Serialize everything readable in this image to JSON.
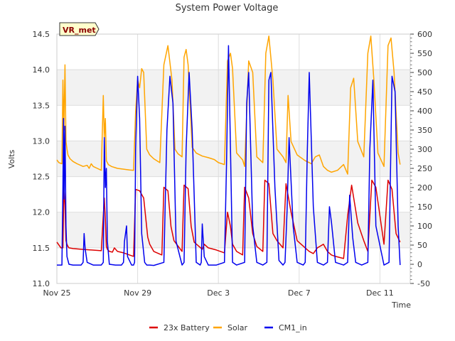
{
  "chart_data": {
    "type": "line",
    "title": "System Power Voltage",
    "xlabel": "Time",
    "ylabel": "Volts",
    "site_badge": "VR_met",
    "x_ticks": [
      "Nov 25",
      "Nov 29",
      "Dec 3",
      "Dec 7",
      "Dec 11"
    ],
    "y_left_ticks": [
      "11.0",
      "11.5",
      "12.0",
      "12.5",
      "13.0",
      "13.5",
      "14.0",
      "14.5"
    ],
    "y_right_ticks": [
      "-50",
      "0",
      "50",
      "100",
      "150",
      "200",
      "250",
      "300",
      "350",
      "400",
      "450",
      "500",
      "550",
      "600"
    ],
    "x_range_days": [
      0,
      17.5
    ],
    "ylim_left": [
      11.0,
      14.5
    ],
    "ylim_right": [
      -50,
      600
    ],
    "legend_position": "bottom-center",
    "series": [
      {
        "name": "23x Battery",
        "axis": "left",
        "color": "#dd0000",
        "note": "x in days since Nov 25",
        "x": [
          0.0,
          0.2,
          0.3,
          0.35,
          0.4,
          0.45,
          0.5,
          0.55,
          0.6,
          0.8,
          1.2,
          2.2,
          2.35,
          2.4,
          2.45,
          2.5,
          2.6,
          2.75,
          2.85,
          3.0,
          3.3,
          3.6,
          3.8,
          3.9,
          4.1,
          4.3,
          4.5,
          4.6,
          4.8,
          5.2,
          5.3,
          5.5,
          5.65,
          5.8,
          6.2,
          6.3,
          6.5,
          6.65,
          6.8,
          7.2,
          7.3,
          7.5,
          7.9,
          8.3,
          8.45,
          8.6,
          8.7,
          8.9,
          9.2,
          9.3,
          9.5,
          9.7,
          9.9,
          10.2,
          10.3,
          10.5,
          10.7,
          10.9,
          11.2,
          11.35,
          11.6,
          11.9,
          12.3,
          12.5,
          12.7,
          12.9,
          13.2,
          13.4,
          13.6,
          13.8,
          14.2,
          14.4,
          14.6,
          14.9,
          15.2,
          15.4,
          15.6,
          15.8,
          16.2,
          16.4,
          16.6,
          16.8,
          17.0
        ],
        "values": [
          11.58,
          11.5,
          11.5,
          12.35,
          12.1,
          11.6,
          11.55,
          11.52,
          11.5,
          11.49,
          11.48,
          11.46,
          12.2,
          11.9,
          11.52,
          11.48,
          11.45,
          11.44,
          11.5,
          11.45,
          11.43,
          11.4,
          11.38,
          12.32,
          12.3,
          12.2,
          11.65,
          11.55,
          11.45,
          11.4,
          12.35,
          12.3,
          11.8,
          11.6,
          11.45,
          12.38,
          12.33,
          11.8,
          11.58,
          11.48,
          11.55,
          11.5,
          11.47,
          11.43,
          12.0,
          11.8,
          11.55,
          11.45,
          11.4,
          12.35,
          12.2,
          11.7,
          11.52,
          11.45,
          12.45,
          12.4,
          11.7,
          11.6,
          11.5,
          12.4,
          12.0,
          11.6,
          11.5,
          11.45,
          11.42,
          11.5,
          11.55,
          11.45,
          11.4,
          11.38,
          11.35,
          11.95,
          12.38,
          11.85,
          11.6,
          11.45,
          12.45,
          12.35,
          11.55,
          12.45,
          12.32,
          11.7,
          11.58
        ]
      },
      {
        "name": "Solar",
        "axis": "right",
        "color": "#ffa500",
        "note": "x in days since Nov 25",
        "x": [
          0.0,
          0.1,
          0.25,
          0.3,
          0.35,
          0.4,
          0.45,
          0.5,
          0.55,
          0.65,
          0.8,
          1.0,
          1.3,
          1.5,
          1.6,
          1.7,
          1.8,
          2.0,
          2.2,
          2.3,
          2.35,
          2.4,
          2.45,
          2.55,
          2.7,
          3.0,
          3.3,
          3.6,
          3.8,
          3.9,
          4.0,
          4.1,
          4.2,
          4.3,
          4.45,
          4.6,
          4.8,
          4.95,
          5.1,
          5.3,
          5.5,
          5.7,
          5.85,
          6.0,
          6.2,
          6.3,
          6.4,
          6.5,
          6.7,
          6.9,
          7.2,
          7.5,
          7.8,
          8.0,
          8.3,
          8.45,
          8.6,
          8.7,
          8.9,
          9.2,
          9.3,
          9.5,
          9.7,
          9.9,
          10.2,
          10.35,
          10.5,
          10.7,
          10.9,
          11.2,
          11.35,
          11.45,
          11.6,
          11.9,
          12.3,
          12.5,
          12.6,
          12.8,
          13.0,
          13.2,
          13.4,
          13.6,
          13.9,
          14.2,
          14.4,
          14.55,
          14.7,
          14.9,
          15.2,
          15.4,
          15.55,
          15.7,
          15.9,
          16.2,
          16.4,
          16.55,
          16.7,
          16.9,
          17.0
        ],
        "values": [
          272,
          265,
          262,
          480,
          350,
          520,
          320,
          300,
          285,
          275,
          268,
          262,
          255,
          258,
          250,
          262,
          255,
          250,
          245,
          440,
          330,
          380,
          270,
          260,
          255,
          250,
          248,
          246,
          245,
          400,
          480,
          460,
          510,
          500,
          300,
          285,
          275,
          270,
          265,
          520,
          570,
          480,
          300,
          288,
          280,
          540,
          560,
          520,
          305,
          290,
          282,
          278,
          273,
          265,
          260,
          530,
          550,
          510,
          290,
          272,
          255,
          530,
          500,
          280,
          265,
          550,
          595,
          480,
          300,
          280,
          265,
          440,
          320,
          285,
          270,
          265,
          262,
          280,
          285,
          255,
          245,
          240,
          245,
          260,
          235,
          460,
          485,
          320,
          280,
          550,
          595,
          480,
          290,
          255,
          570,
          590,
          500,
          290,
          260
        ]
      },
      {
        "name": "CM1_in",
        "axis": "right",
        "color": "#0000ee",
        "note": "x in days since Nov 25",
        "x": [
          0.0,
          0.25,
          0.3,
          0.33,
          0.36,
          0.4,
          0.45,
          0.5,
          0.6,
          0.8,
          1.2,
          1.3,
          1.35,
          1.4,
          1.5,
          1.8,
          2.2,
          2.3,
          2.35,
          2.4,
          2.45,
          2.5,
          2.6,
          2.9,
          3.2,
          3.3,
          3.35,
          3.45,
          3.5,
          3.7,
          3.8,
          3.85,
          3.9,
          4.0,
          4.1,
          4.2,
          4.35,
          4.45,
          4.6,
          4.8,
          5.3,
          5.45,
          5.6,
          5.75,
          5.9,
          6.2,
          6.3,
          6.4,
          6.55,
          6.7,
          6.9,
          7.1,
          7.15,
          7.2,
          7.3,
          7.5,
          7.9,
          8.3,
          8.4,
          8.5,
          8.6,
          8.7,
          8.9,
          9.3,
          9.4,
          9.5,
          9.7,
          9.9,
          10.2,
          10.4,
          10.5,
          10.6,
          10.8,
          11.0,
          11.2,
          11.3,
          11.4,
          11.5,
          11.7,
          11.9,
          12.2,
          12.3,
          12.4,
          12.5,
          12.7,
          12.9,
          13.2,
          13.4,
          13.5,
          13.6,
          13.8,
          14.2,
          14.4,
          14.5,
          14.65,
          14.8,
          15.1,
          15.4,
          15.5,
          15.65,
          15.8,
          16.2,
          16.45,
          16.6,
          16.75,
          16.9,
          17.0
        ],
        "values": [
          -2,
          -2,
          200,
          380,
          170,
          360,
          100,
          20,
          0,
          -2,
          -2,
          5,
          80,
          40,
          5,
          -2,
          -2,
          5,
          330,
          200,
          250,
          60,
          0,
          -2,
          -2,
          5,
          60,
          100,
          20,
          -2,
          -2,
          5,
          300,
          490,
          380,
          80,
          5,
          -2,
          -2,
          -3,
          5,
          350,
          490,
          420,
          60,
          -2,
          5,
          300,
          500,
          350,
          5,
          -2,
          5,
          105,
          20,
          -2,
          -2,
          5,
          260,
          570,
          300,
          5,
          -2,
          5,
          420,
          500,
          100,
          5,
          -2,
          5,
          480,
          500,
          200,
          10,
          -2,
          5,
          140,
          330,
          100,
          5,
          -2,
          5,
          290,
          500,
          150,
          5,
          -2,
          5,
          150,
          110,
          5,
          -2,
          5,
          180,
          70,
          5,
          -2,
          5,
          300,
          480,
          100,
          -2,
          5,
          490,
          450,
          100,
          -2
        ]
      }
    ]
  }
}
